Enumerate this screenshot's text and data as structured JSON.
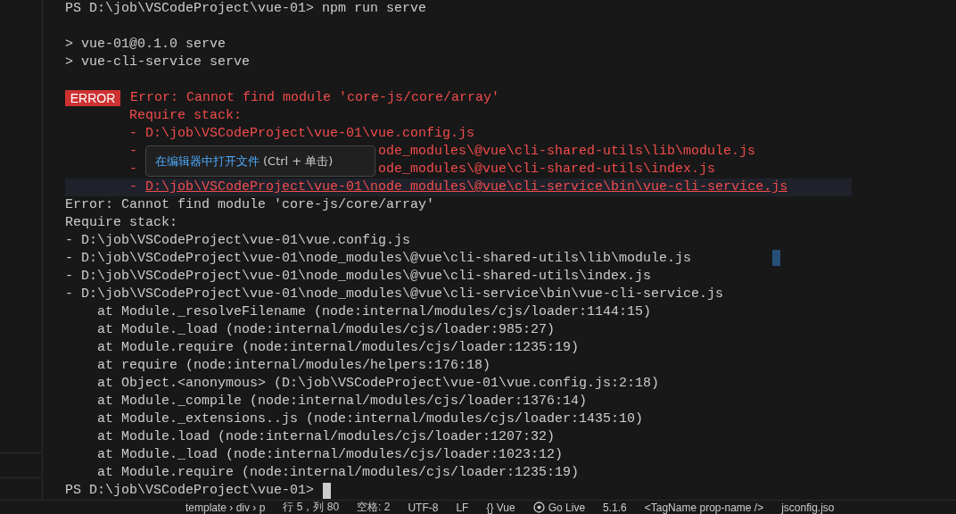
{
  "terminal": {
    "lines": [
      {
        "kind": "plain",
        "text": "PS D:\\job\\VSCodeProject\\vue-01> npm run serve"
      },
      {
        "kind": "blank"
      },
      {
        "kind": "plain",
        "text": "> vue-01@0.1.0 serve"
      },
      {
        "kind": "plain",
        "text": "> vue-cli-service serve"
      },
      {
        "kind": "blank"
      },
      {
        "kind": "error_head",
        "badge": "ERROR",
        "text": "Error: Cannot find module 'core-js/core/array'"
      },
      {
        "kind": "red",
        "text": "Require stack:"
      },
      {
        "kind": "red",
        "text": "- D:\\job\\VSCodeProject\\vue-01\\vue.config.js"
      },
      {
        "kind": "red_covered",
        "lead": "-",
        "text": "ode_modules\\@vue\\cli-shared-utils\\lib\\module.js"
      },
      {
        "kind": "red_covered",
        "lead": "-",
        "text": "ode_modules\\@vue\\cli-shared-utils\\index.js"
      },
      {
        "kind": "red_link",
        "lead": "-",
        "text": "D:\\job\\VSCodeProject\\vue-01\\node_modules\\@vue\\cli-service\\bin\\vue-cli-service.js"
      },
      {
        "kind": "plain",
        "text": "Error: Cannot find module 'core-js/core/array'"
      },
      {
        "kind": "plain",
        "text": "Require stack:"
      },
      {
        "kind": "plain",
        "text": "- D:\\job\\VSCodeProject\\vue-01\\vue.config.js"
      },
      {
        "kind": "plain",
        "text": "- D:\\job\\VSCodeProject\\vue-01\\node_modules\\@vue\\cli-shared-utils\\lib\\module.js"
      },
      {
        "kind": "plain",
        "text": "- D:\\job\\VSCodeProject\\vue-01\\node_modules\\@vue\\cli-shared-utils\\index.js"
      },
      {
        "kind": "plain",
        "text": "- D:\\job\\VSCodeProject\\vue-01\\node_modules\\@vue\\cli-service\\bin\\vue-cli-service.js"
      },
      {
        "kind": "stack",
        "text": "at Module._resolveFilename (node:internal/modules/cjs/loader:1144:15)"
      },
      {
        "kind": "stack",
        "text": "at Module._load (node:internal/modules/cjs/loader:985:27)"
      },
      {
        "kind": "stack",
        "text": "at Module.require (node:internal/modules/cjs/loader:1235:19)"
      },
      {
        "kind": "stack",
        "text": "at require (node:internal/modules/helpers:176:18)"
      },
      {
        "kind": "stack",
        "text": "at Object.<anonymous> (D:\\job\\VSCodeProject\\vue-01\\vue.config.js:2:18)"
      },
      {
        "kind": "stack",
        "text": "at Module._compile (node:internal/modules/cjs/loader:1376:14)"
      },
      {
        "kind": "stack",
        "text": "at Module._extensions..js (node:internal/modules/cjs/loader:1435:10)"
      },
      {
        "kind": "stack",
        "text": "at Module.load (node:internal/modules/cjs/loader:1207:32)"
      },
      {
        "kind": "stack",
        "text": "at Module._load (node:internal/modules/cjs/loader:1023:12)"
      },
      {
        "kind": "stack",
        "text": "at Module.require (node:internal/modules/cjs/loader:1235:19)"
      },
      {
        "kind": "prompt_cursor",
        "text": "PS D:\\job\\VSCodeProject\\vue-01>"
      }
    ]
  },
  "tooltip": {
    "action": "在编辑器中打开文件",
    "shortcut": "(Ctrl + 单击)"
  },
  "status_bar": {
    "items": [
      {
        "kind": "text",
        "text": "template › div › p"
      },
      {
        "kind": "text",
        "text": "行 5，列 80"
      },
      {
        "kind": "text",
        "text": "空格: 2"
      },
      {
        "kind": "text",
        "text": "UTF-8"
      },
      {
        "kind": "text",
        "text": "LF"
      },
      {
        "kind": "text",
        "text": "{} Vue"
      },
      {
        "kind": "live",
        "text": "Go Live"
      },
      {
        "kind": "text",
        "text": "5.1.6"
      },
      {
        "kind": "text",
        "text": "<TagName prop-name />"
      },
      {
        "kind": "text",
        "text": "jsconfig.jso"
      }
    ]
  }
}
